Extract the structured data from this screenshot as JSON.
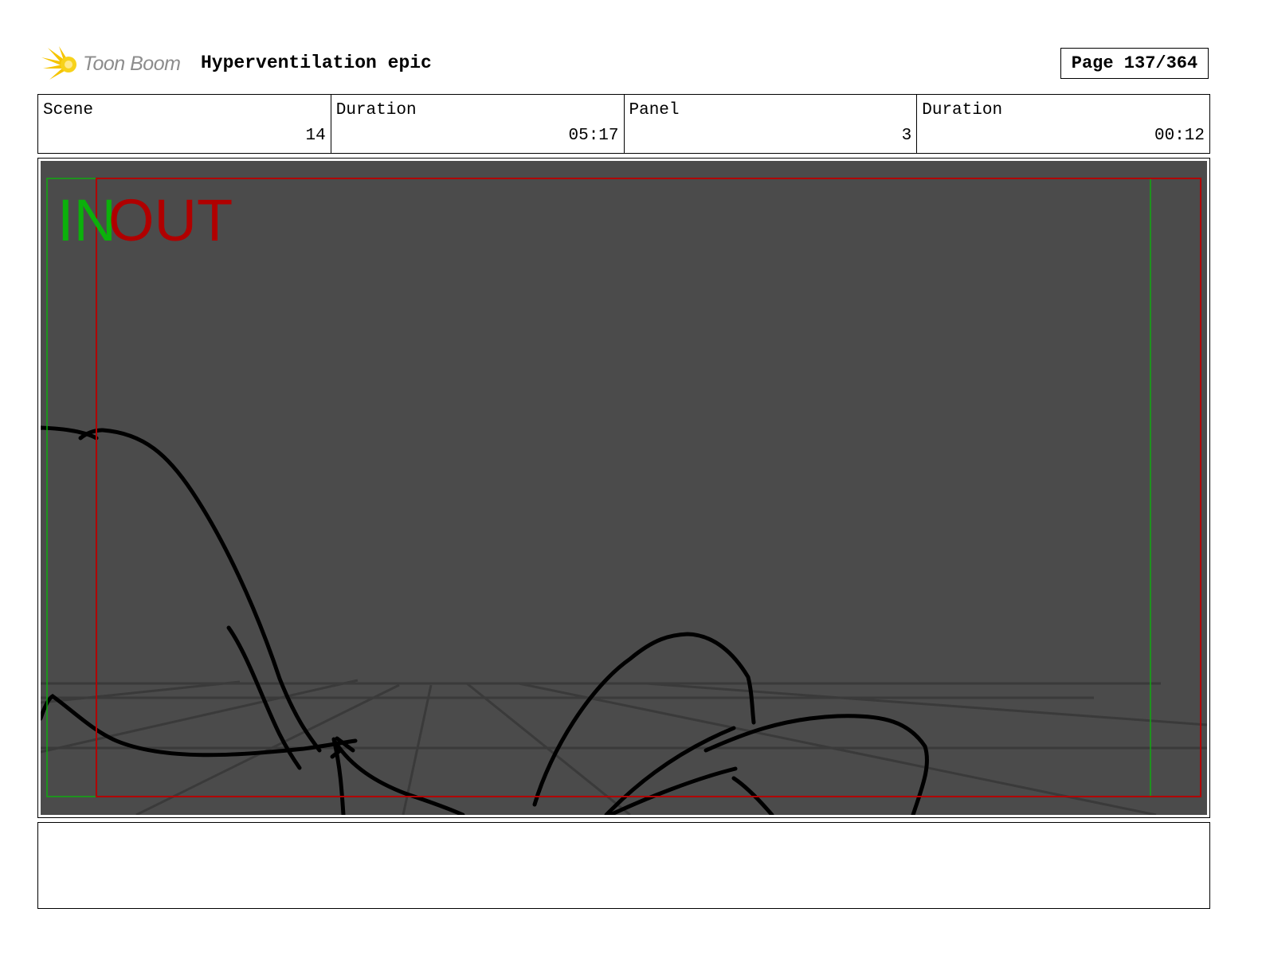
{
  "header": {
    "logo_text": "Toon Boom",
    "project_title": "Hyperventilation epic",
    "page_label": "Page 137/364"
  },
  "info": [
    {
      "label": "Scene",
      "value": "14"
    },
    {
      "label": "Duration",
      "value": "05:17"
    },
    {
      "label": "Panel",
      "value": "3"
    },
    {
      "label": "Duration",
      "value": "00:12"
    }
  ],
  "panel": {
    "in_label": "IN",
    "out_label": "OUT",
    "colors": {
      "background": "#4b4b4b",
      "in_frame": "#0bb10b",
      "out_frame": "#b00000",
      "sketch": "#000000"
    }
  },
  "notes": {
    "text": ""
  }
}
